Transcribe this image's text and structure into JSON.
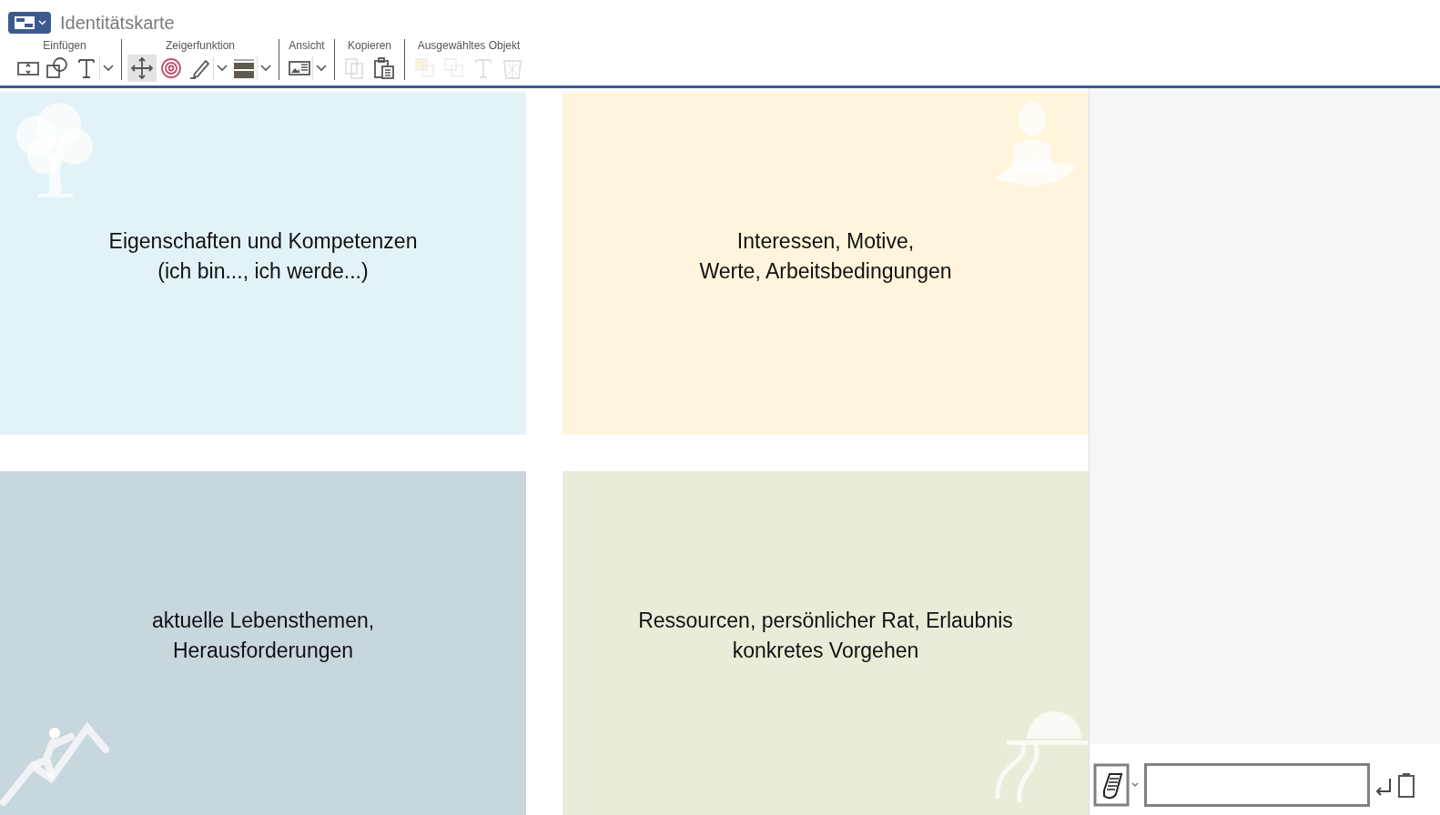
{
  "window": {
    "title": "Identitätskarte"
  },
  "toolbar": [
    {
      "label": "Einfügen",
      "tools": [
        {
          "kind": "frame",
          "selected": false,
          "disabled": false,
          "dropdown": false
        },
        {
          "kind": "shapes",
          "selected": false,
          "disabled": false,
          "dropdown": false
        },
        {
          "kind": "text",
          "selected": false,
          "disabled": false,
          "dropdown": true
        }
      ]
    },
    {
      "label": "Zeigerfunktion",
      "tools": [
        {
          "kind": "move",
          "selected": true,
          "disabled": false,
          "dropdown": false
        },
        {
          "kind": "target",
          "selected": false,
          "disabled": false,
          "dropdown": false
        },
        {
          "kind": "pen",
          "selected": false,
          "disabled": false,
          "dropdown": true
        },
        {
          "kind": "lines",
          "selected": false,
          "disabled": false,
          "dropdown": true
        }
      ]
    },
    {
      "label": "Ansicht",
      "tools": [
        {
          "kind": "view",
          "selected": false,
          "disabled": false,
          "dropdown": true
        }
      ]
    },
    {
      "label": "Kopieren",
      "tools": [
        {
          "kind": "copy",
          "selected": false,
          "disabled": true,
          "dropdown": false
        },
        {
          "kind": "paste",
          "selected": false,
          "disabled": false,
          "dropdown": false
        }
      ]
    },
    {
      "label": "Ausgewähltes Objekt",
      "tools": [
        {
          "kind": "front",
          "selected": false,
          "disabled": true,
          "dropdown": false
        },
        {
          "kind": "back",
          "selected": false,
          "disabled": true,
          "dropdown": false
        },
        {
          "kind": "text",
          "selected": false,
          "disabled": true,
          "dropdown": false
        },
        {
          "kind": "trash",
          "selected": false,
          "disabled": true,
          "dropdown": false
        }
      ]
    }
  ],
  "quadrants": [
    {
      "text": "Eigenschaften und Kompetenzen\n(ich bin..., ich werde...)",
      "color": "#e3f2f6",
      "kind": "tree"
    },
    {
      "text": "Interessen, Motive,\nWerte, Arbeitsbedingungen",
      "color": "#fef5dc",
      "kind": "person"
    },
    {
      "text": "aktuelle Lebensthemen,\nHerausforderungen",
      "color": "#c8d6dd",
      "kind": "climber"
    },
    {
      "text": "Ressourcen, persönlicher Rat, Erlaubnis\nkonkretes Vorgehen",
      "color": "#e8edd9",
      "kind": "sunrise"
    }
  ]
}
